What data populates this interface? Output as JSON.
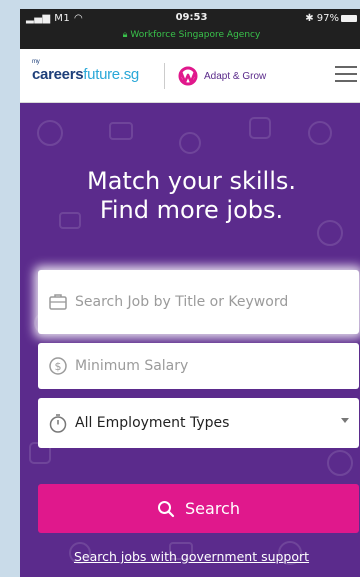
{
  "status_bar": {
    "carrier": "M1",
    "time": "09:53",
    "battery": "97%",
    "agency": "Workforce Singapore Agency"
  },
  "header": {
    "logo_prefix_small": "my",
    "logo_careers": "careers",
    "logo_future": "future.sg",
    "partner_logo_text": "Adapt & Grow",
    "icons": [
      "menu-icon"
    ]
  },
  "hero": {
    "headline_line1": "Match your skills.",
    "headline_line2": "Find more jobs.",
    "search": {
      "placeholder": "Search Job by Title or Keyword",
      "icon": "briefcase-icon"
    },
    "salary": {
      "placeholder": "Minimum Salary",
      "icon": "dollar-icon"
    },
    "employment_type": {
      "selected": "All Employment Types",
      "icon": "stopwatch-icon"
    },
    "search_button_label": "Search",
    "gov_support_link": "Search jobs with government support"
  },
  "colors": {
    "brand_purple": "#5b2b8c",
    "cta_pink": "#e0188c",
    "logo_navy": "#1d3f7a",
    "logo_cyan": "#2aa8d8"
  }
}
